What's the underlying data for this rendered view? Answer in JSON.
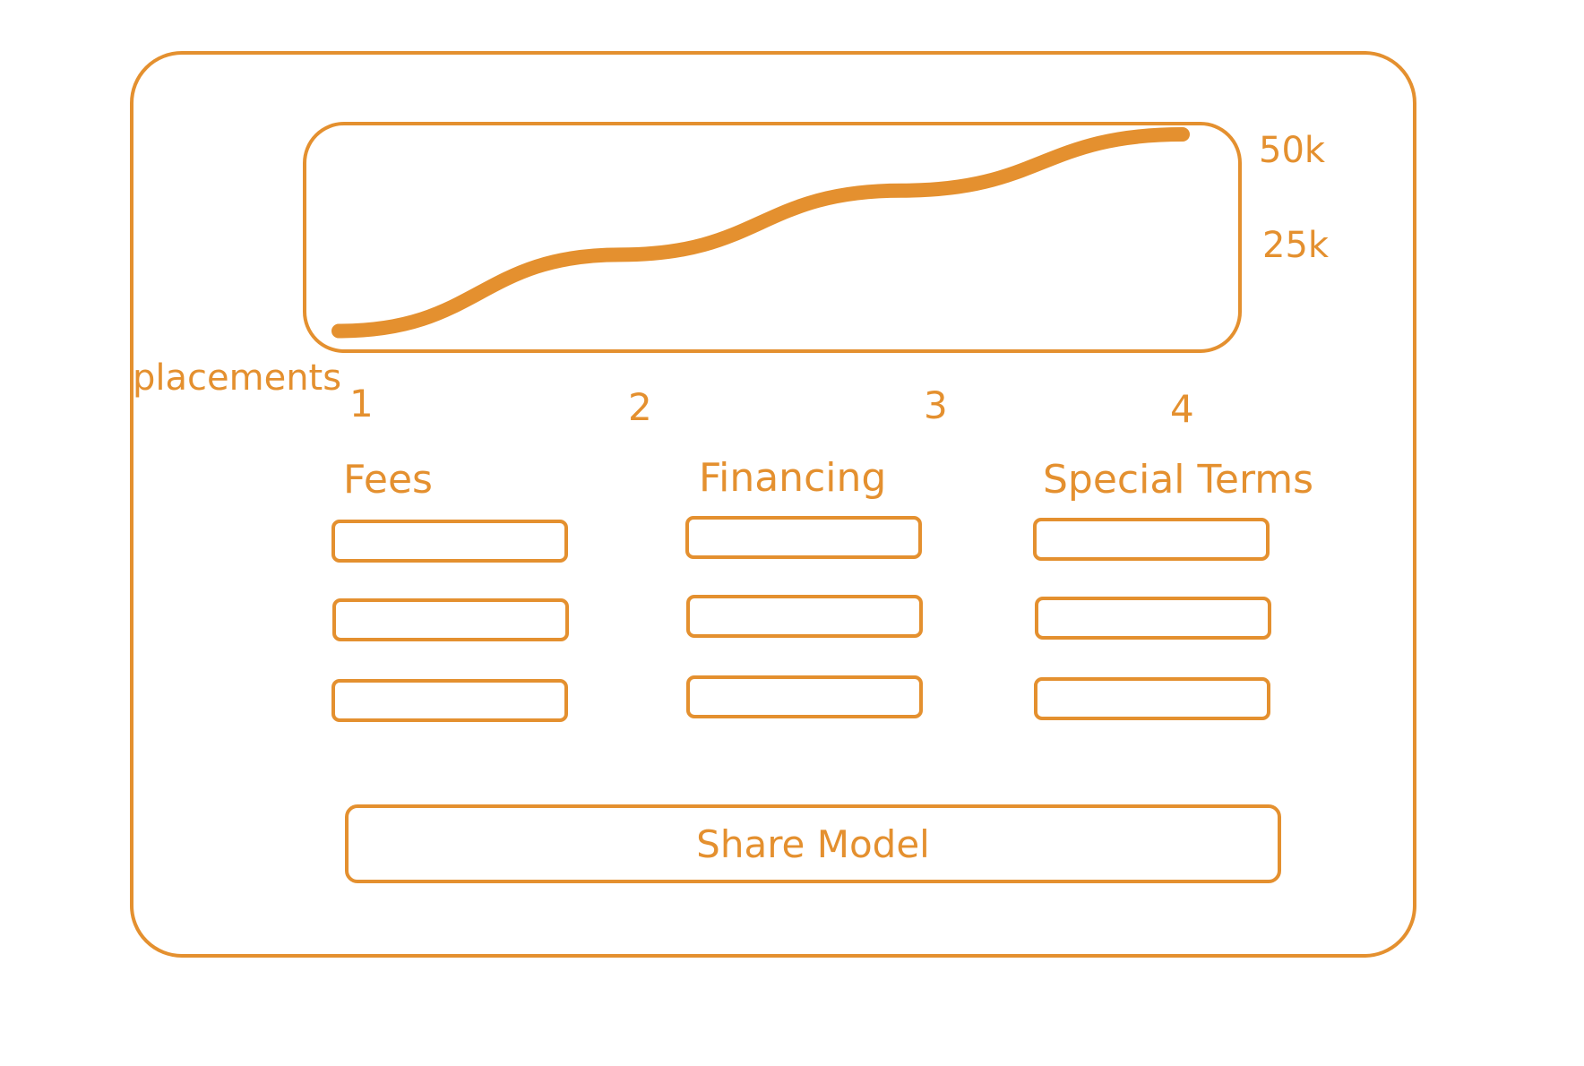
{
  "colors": {
    "stroke": "#e4902f",
    "background": "#ffffff"
  },
  "chart_data": {
    "type": "line",
    "x": [
      1,
      2,
      3,
      4
    ],
    "series": [
      {
        "values": [
          1000,
          20000,
          36000,
          50000
        ]
      }
    ],
    "xticks": [
      "1",
      "2",
      "3",
      "4"
    ],
    "yticks": [
      "50k",
      "25k"
    ],
    "xlabel": "placements",
    "ylabel": "",
    "ylim": [
      0,
      50000
    ],
    "grid": false
  },
  "columns": [
    {
      "title": "Fees",
      "fields": [
        "",
        "",
        ""
      ]
    },
    {
      "title": "Financing",
      "fields": [
        "",
        "",
        ""
      ]
    },
    {
      "title": "Special Terms",
      "fields": [
        "",
        "",
        ""
      ]
    }
  ],
  "actions": {
    "share_label": "Share Model"
  }
}
